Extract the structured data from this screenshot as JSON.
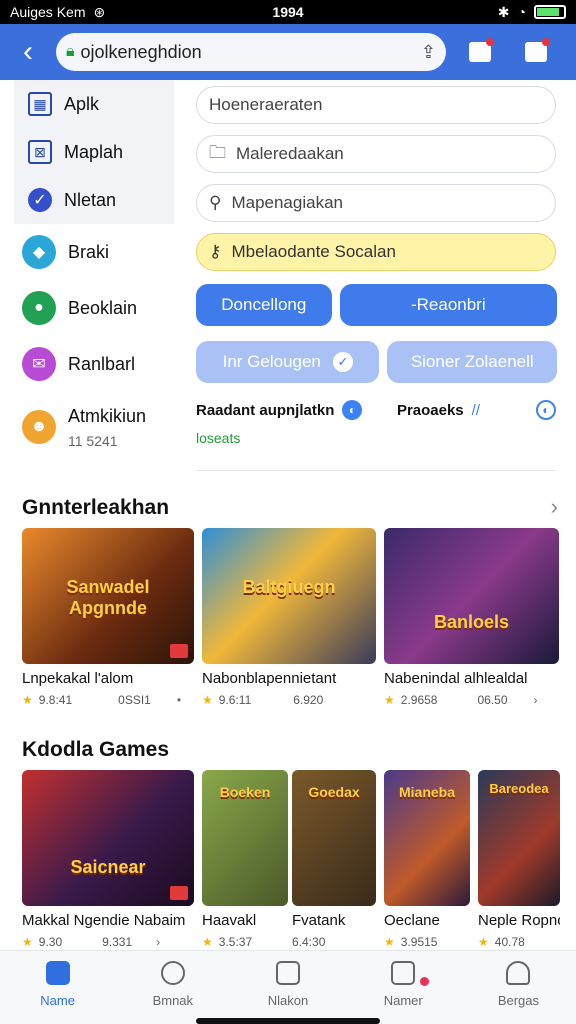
{
  "status": {
    "carrier": "Auiges Kem",
    "time": "1994"
  },
  "url": {
    "text": "ojolkeneghdion"
  },
  "sidebar": {
    "items": [
      {
        "label": "Aplk"
      },
      {
        "label": "Maplah"
      },
      {
        "label": "Nletan"
      }
    ],
    "apps": [
      {
        "label": "Braki",
        "color": "#2aa7d6"
      },
      {
        "label": "Beoklain",
        "color": "#22a155"
      },
      {
        "label": "Ranlbarl",
        "color": "#b84bd3"
      },
      {
        "label": "Atmkikiun",
        "sub": "11 5241",
        "color": "#f0a530"
      }
    ]
  },
  "fields": [
    {
      "text": "Hoeneraeraten"
    },
    {
      "text": "Maleredaakan"
    },
    {
      "text": "Mapenagiakan"
    },
    {
      "text": "Mbelaodante Socalan"
    }
  ],
  "buttons": {
    "row1": [
      "Doncellong",
      "-Reaonbri"
    ],
    "row2": [
      "Inr Gelougen",
      "Sioner Zolaenell"
    ]
  },
  "info": {
    "left": "Raadant aupnjlatkn",
    "right": "Praoaeks",
    "green": "loseats"
  },
  "sections": [
    {
      "title": "Gnnterleakhan",
      "games": [
        {
          "title": "Lnpekakal l'alom",
          "art": "Sanwadel Apgnnde",
          "rating": "9.8:41",
          "downloads": "0SSI1",
          "extra": "•"
        },
        {
          "title": "Nabonblapennietant",
          "art": "Baltgiuegn",
          "rating": "9.6:11",
          "downloads": "6.920",
          "extra": ""
        },
        {
          "title": "Nabenindal alhlealdal",
          "art": "Banloels",
          "rating": "2.9658",
          "downloads": "06.50",
          "extra": "›"
        }
      ]
    },
    {
      "title": "Kdodla Games",
      "games": [
        {
          "title": "Makkal Ngendie Nabaim",
          "art": "Saicnear",
          "rating": "9.30",
          "downloads": "9.331",
          "extra": "›"
        },
        {
          "title": "Haavakl",
          "art": "Boeken",
          "rating": "3.5:37",
          "downloads": "6.4:30",
          "extra": ""
        },
        {
          "title": "Fvatank",
          "art": "Goedax",
          "rating": "",
          "downloads": "",
          "extra": ""
        },
        {
          "title": "Oeclane",
          "art": "Mianeba",
          "rating": "3.9515",
          "downloads": "",
          "extra": ""
        },
        {
          "title": "Neple Ropno",
          "art": "Bareodea",
          "rating": "40.78",
          "downloads": "",
          "extra": ""
        }
      ]
    }
  ],
  "tabs": [
    {
      "label": "Name"
    },
    {
      "label": "Bmnak"
    },
    {
      "label": "Nlakon"
    },
    {
      "label": "Namer"
    },
    {
      "label": "Bergas"
    }
  ]
}
